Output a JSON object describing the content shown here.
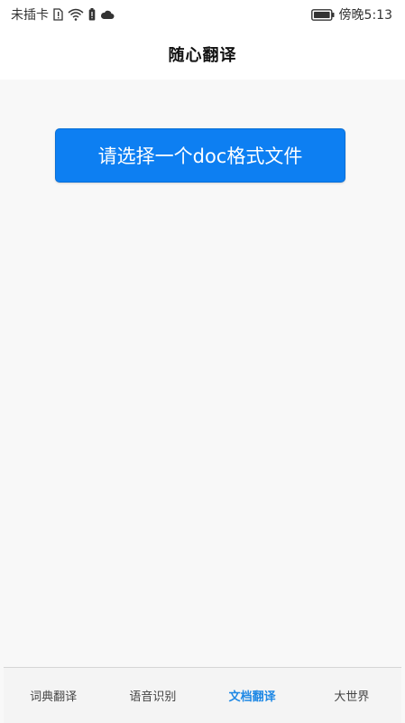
{
  "status_bar": {
    "carrier": "未插卡",
    "time": "傍晚5:13",
    "icons": [
      "sim-alert-icon",
      "wifi-icon",
      "battery-low-icon",
      "cloud-icon"
    ]
  },
  "header": {
    "title": "随心翻译"
  },
  "main": {
    "select_button_label": "请选择一个doc格式文件"
  },
  "bottom_nav": {
    "active_index": 2,
    "tabs": [
      {
        "label": "词典翻译"
      },
      {
        "label": "语音识别"
      },
      {
        "label": "文档翻译"
      },
      {
        "label": "大世界"
      }
    ]
  },
  "colors": {
    "accent": "#0d7ff2",
    "active_tab": "#1e88e5",
    "background": "#f8f8f8"
  }
}
